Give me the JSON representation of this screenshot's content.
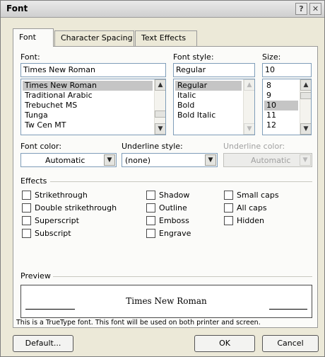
{
  "window": {
    "title": "Font",
    "help_label": "?",
    "close_label": "✕"
  },
  "tabs": [
    "Font",
    "Character Spacing",
    "Text Effects"
  ],
  "font": {
    "label": "Font:",
    "value": "Times New Roman",
    "list": [
      "Times New Roman",
      "Traditional Arabic",
      "Trebuchet MS",
      "Tunga",
      "Tw Cen MT"
    ],
    "selected": "Times New Roman"
  },
  "font_style": {
    "label": "Font style:",
    "value": "Regular",
    "list": [
      "Regular",
      "Italic",
      "Bold",
      "Bold Italic"
    ],
    "selected": "Regular"
  },
  "size": {
    "label": "Size:",
    "value": "10",
    "list": [
      "8",
      "9",
      "10",
      "11",
      "12"
    ],
    "selected": "10"
  },
  "font_color": {
    "label": "Font color:",
    "value": "Automatic"
  },
  "underline_style": {
    "label": "Underline style:",
    "value": "(none)"
  },
  "underline_color": {
    "label": "Underline color:",
    "value": "Automatic"
  },
  "effects": {
    "label": "Effects",
    "col1": [
      "Strikethrough",
      "Double strikethrough",
      "Superscript",
      "Subscript"
    ],
    "col2": [
      "Shadow",
      "Outline",
      "Emboss",
      "Engrave"
    ],
    "col3": [
      "Small caps",
      "All caps",
      "Hidden"
    ]
  },
  "preview": {
    "label": "Preview",
    "sample": "Times New Roman",
    "note": "This is a TrueType font. This font will be used on both printer and screen."
  },
  "buttons": {
    "default": "Default...",
    "ok": "OK",
    "cancel": "Cancel"
  },
  "icons": {
    "dropdown": "chevron-down-icon",
    "scroll_up": "chevron-up-icon",
    "scroll_down": "chevron-down-icon"
  }
}
